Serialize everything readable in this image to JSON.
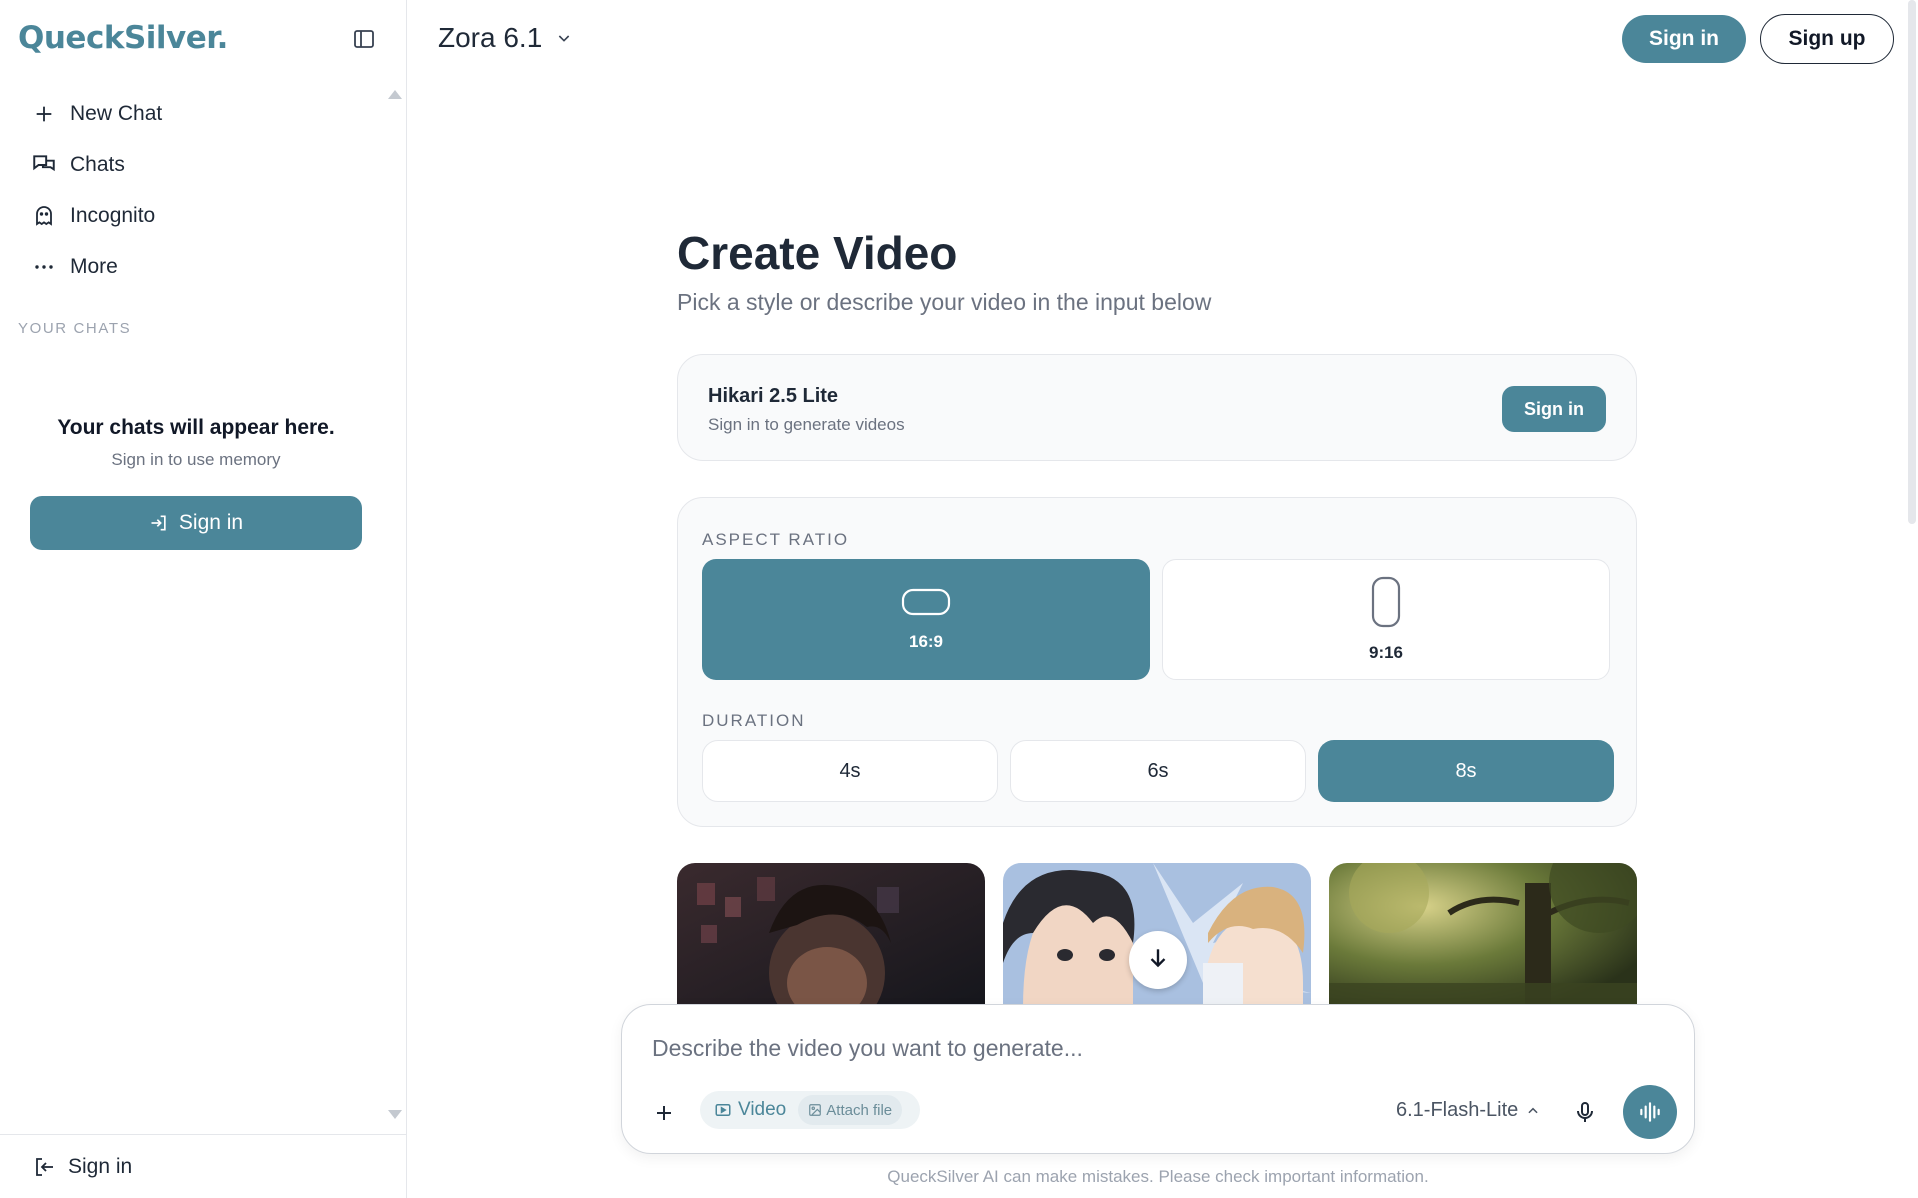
{
  "sidebar": {
    "logo": "QueckSilver.",
    "nav": [
      {
        "label": "New Chat",
        "icon": "plus-icon"
      },
      {
        "label": "Chats",
        "icon": "chats-icon"
      },
      {
        "label": "Incognito",
        "icon": "ghost-icon"
      },
      {
        "label": "More",
        "icon": "more-icon"
      }
    ],
    "section_label": "YOUR CHATS",
    "empty_title": "Your chats will appear here.",
    "empty_subtitle": "Sign in to use memory",
    "signin_label": "Sign in",
    "bottom_signin_label": "Sign in"
  },
  "header": {
    "model_name": "Zora 6.1",
    "signin_label": "Sign in",
    "signup_label": "Sign up"
  },
  "main": {
    "title": "Create Video",
    "subtitle": "Pick a style or describe your video in the input below",
    "model_card": {
      "name": "Hikari 2.5 Lite",
      "hint": "Sign in to generate videos",
      "button_label": "Sign in"
    },
    "aspect_ratio": {
      "label": "ASPECT RATIO",
      "options": [
        "16:9",
        "9:16"
      ],
      "selected": "16:9"
    },
    "duration": {
      "label": "DURATION",
      "options": [
        "4s",
        "6s",
        "8s"
      ],
      "selected": "8s"
    }
  },
  "composer": {
    "placeholder": "Describe the video you want to generate...",
    "mode_label": "Video",
    "attach_label": "Attach file",
    "model_label": "6.1-Flash-Lite"
  },
  "disclaimer": "QueckSilver AI can make mistakes. Please check important information.",
  "colors": {
    "accent": "#4b8699",
    "border": "#e5e7eb",
    "muted_text": "#6b7280"
  }
}
